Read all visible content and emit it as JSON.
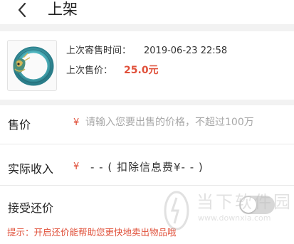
{
  "header": {
    "title": "上架",
    "back_icon": "chevron-left-icon"
  },
  "item": {
    "image_icon": "dragon-jade-ring-icon",
    "last_listed_label": "上次寄售时间：",
    "last_listed_value": "2019-06-23 22:58",
    "last_price_label": "上次售价：",
    "last_price_value": "25.0元"
  },
  "price": {
    "label": "售价",
    "currency": "¥",
    "placeholder": "请输入您要出售的价格，不超过100万",
    "value": ""
  },
  "net_income": {
    "label": "实际收入",
    "currency": "¥",
    "value": "- - ( 扣除信息费¥- - )"
  },
  "counter_offer": {
    "label": "接受还价",
    "enabled": false,
    "hint": "提示：开启还价能帮助您更快地卖出物品哦"
  },
  "watermark": {
    "text": "当下软件园",
    "url": "www.downxia.com"
  },
  "colors": {
    "accent": "#e0503a",
    "divider": "#f2f2f2",
    "toggle_off": "#d7d7d7"
  }
}
